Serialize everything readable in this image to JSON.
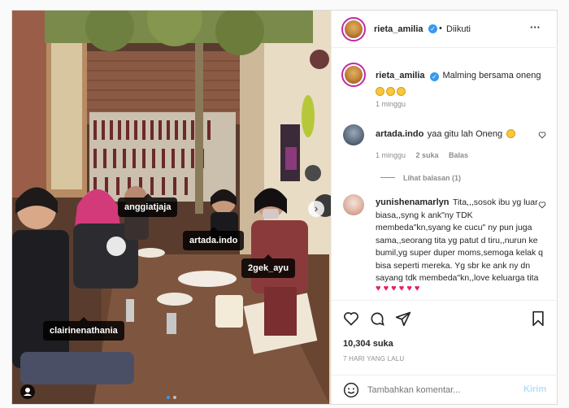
{
  "post": {
    "tags": [
      "anggiatjaja",
      "artada.indo",
      "2gek_ayu",
      "clairinenathania"
    ],
    "carousel_next": "›"
  },
  "header": {
    "username": "rieta_amilia",
    "separator": "•",
    "follow_status": "Diikuti",
    "more": "···"
  },
  "caption": {
    "username": "rieta_amilia",
    "text": "Malming bersama oneng",
    "time": "1 minggu"
  },
  "comments": [
    {
      "username": "artada.indo",
      "text": "yaa gitu lah Oneng",
      "time": "1 minggu",
      "likes": "2 suka",
      "reply": "Balas",
      "view_replies": "Lihat balasan (1)"
    },
    {
      "username": "yunishenamarlyn",
      "text": "Tita,,,sosok ibu yg luar biasa,,syng k ank\"ny TDK membeda\"kn,syang ke cucu\" ny pun juga sama,,seorang tita yg patut d tiru,,nurun ke bumil,yg super duper moms,semoga kelak q bisa seperti mereka. Yg sbr ke ank ny dn sayang tdk membeda\"kn,,love keluarga tita",
      "hearts": "♥ ♥ ♥ ♥ ♥ ♥"
    }
  ],
  "actions": {
    "likes": "10,304 suka",
    "date": "7 HARI YANG LALU"
  },
  "comment_box": {
    "placeholder": "Tambahkan komentar...",
    "submit": "Kirim"
  }
}
